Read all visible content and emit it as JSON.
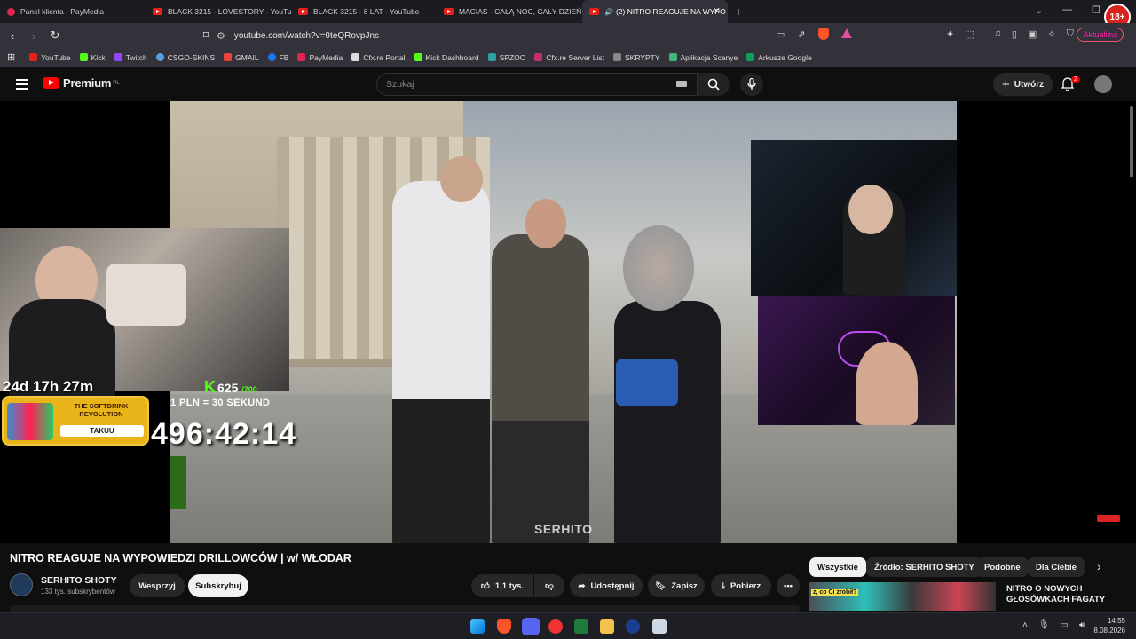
{
  "browser": {
    "tabs": [
      {
        "label": "Panel klienta - PayMedia",
        "icon": "paymedia-icon",
        "active": false
      },
      {
        "label": "BLACK 3215 - LOVESTORY - YouTube",
        "icon": "youtube-icon",
        "active": false
      },
      {
        "label": "BLACK 3215 - 8 LAT - YouTube",
        "icon": "youtube-icon",
        "active": false
      },
      {
        "label": "MACIAS - CAŁĄ NOC, CAŁY DZIEŃ -",
        "icon": "youtube-icon",
        "active": false
      },
      {
        "label": "(2) NITRO REAGUJE NA WYPO",
        "icon": "youtube-icon",
        "active": true
      }
    ],
    "age_badge": "18+",
    "url": "youtube.com/watch?v=9teQRovpJns",
    "update_label": "Aktualizuj",
    "bookmarks": [
      {
        "label": "YouTube",
        "color": "#e62117"
      },
      {
        "label": "Kick",
        "color": "#53fc18"
      },
      {
        "label": "Twitch",
        "color": "#9146ff"
      },
      {
        "label": "CSGO-SKINS",
        "color": "#5aa0e0"
      },
      {
        "label": "GMAIL",
        "color": "#ea4335"
      },
      {
        "label": "FB",
        "color": "#1877f2"
      },
      {
        "label": "PayMedia",
        "color": "#e0234f"
      },
      {
        "label": "Cfx.re Portal",
        "color": "#dddddd"
      },
      {
        "label": "Kick Dashboard",
        "color": "#53fc18"
      },
      {
        "label": "SPZOO",
        "color": "#2ea0a0"
      },
      {
        "label": "Cfx.re Server List",
        "color": "#c0306a"
      },
      {
        "label": "SKRYPTY",
        "color": "#888888"
      },
      {
        "label": "Aplikacja Scanye",
        "color": "#3cb878"
      },
      {
        "label": "Arkusze Google",
        "color": "#0f9d58"
      }
    ]
  },
  "youtube": {
    "logo_text": "Premium",
    "logo_region": "PL",
    "search_placeholder": "Szukaj",
    "create_label": "Utwórz",
    "notifications_count": "2",
    "overlay": {
      "timer": "24d 17h 27m",
      "promo_title": "THE SOFTDRINK REVOLUTION",
      "promo_button": "TAKUU",
      "kick_count": "625",
      "kick_total": "/700",
      "rate_text": "1 PLN = 30 SEKUND",
      "counter": "496:42:14",
      "watermark": "SERHITO"
    },
    "video_title": "NITRO REAGUJE NA WYPOWIEDZI DRILLOWCÓW | w/ WŁODAR",
    "channel_name": "SERHITO SHOTY",
    "subscribers": "133 tys. subskrybentów",
    "support_label": "Wesprzyj",
    "subscribe_label": "Subskrybuj",
    "likes": "1,1 tys.",
    "share_label": "Udostępnij",
    "save_label": "Zapisz",
    "download_label": "Pobierz",
    "chips": [
      "Wszystkie",
      "Źródło: SERHITO SHOTY",
      "Podobne",
      "Dla Ciebie"
    ],
    "rec_title": "NITRO O NOWYCH GŁOSÓWKACH FAGATY",
    "rec_thumb_text": "z, co Ci zrobił?"
  },
  "taskbar": {
    "time": "14:55",
    "date": "8.08.2026"
  }
}
